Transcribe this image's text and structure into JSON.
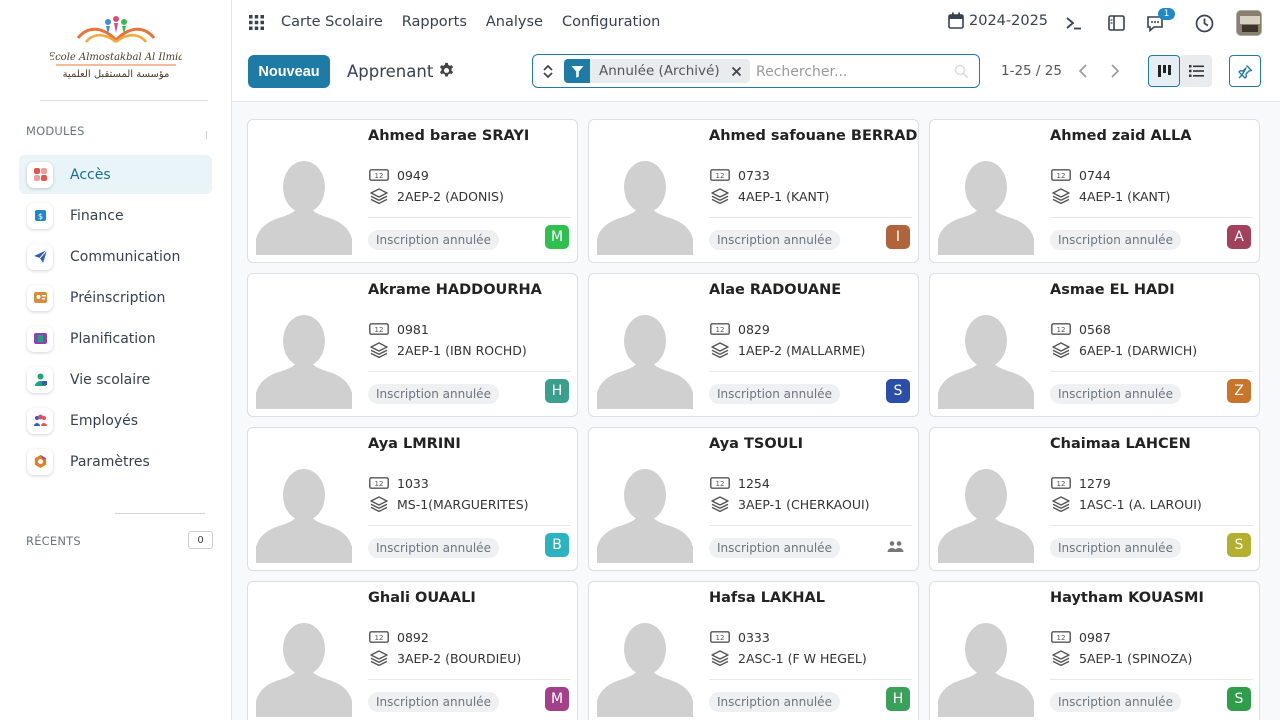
{
  "brand": {
    "logo_text_latin": "Ecole Almostakbal Al Ilmia",
    "logo_text_arabic": "مؤسسة المستقبل العلمية"
  },
  "sidebar": {
    "modules_title": "MODULES",
    "items": [
      {
        "label": "Accès",
        "icon": "access-icon",
        "color": "#e5534b",
        "active": true
      },
      {
        "label": "Finance",
        "icon": "finance-icon",
        "color": "#1e88c8",
        "active": false
      },
      {
        "label": "Communication",
        "icon": "send-icon",
        "color": "#2e5cb8",
        "active": false
      },
      {
        "label": "Préinscription",
        "icon": "enrollment-icon",
        "color": "#d98a3a",
        "active": false
      },
      {
        "label": "Planification",
        "icon": "calendar-icon",
        "color": "#8e44ad",
        "active": false
      },
      {
        "label": "Vie scolaire",
        "icon": "student-life-icon",
        "color": "#1aa57a",
        "active": false
      },
      {
        "label": "Employés",
        "icon": "employees-icon",
        "color": "#d94b7b",
        "active": false
      },
      {
        "label": "Paramètres",
        "icon": "settings-icon",
        "color": "#e67e22",
        "active": false
      }
    ],
    "recents_title": "RÉCENTS",
    "recents_count": "0"
  },
  "topbar": {
    "menu": [
      "Carte Scolaire",
      "Rapports",
      "Analyse",
      "Configuration"
    ],
    "year": "2024-2025",
    "chat_badge": "1"
  },
  "control": {
    "new_button": "Nouveau",
    "title": "Apprenant",
    "facet_label": "Annulée (Archivé)",
    "search_placeholder": "Rechercher...",
    "pager": "1-25 / 25"
  },
  "cards": [
    {
      "name": "Ahmed barae SRAYI",
      "code": "0949",
      "class": "2AEP-2 (ADONIS)",
      "status": "Inscription annulée",
      "letter": "M",
      "color": "#2ebf4f"
    },
    {
      "name": "Ahmed safouane BERRAD",
      "code": "0733",
      "class": "4AEP-1 (KANT)",
      "status": "Inscription annulée",
      "letter": "I",
      "color": "#b0643a"
    },
    {
      "name": "Ahmed zaid ALLA",
      "code": "0744",
      "class": "4AEP-1 (KANT)",
      "status": "Inscription annulée",
      "letter": "A",
      "color": "#a3405a"
    },
    {
      "name": "Akrame HADDOURHA",
      "code": "0981",
      "class": "2AEP-1 (IBN ROCHD)",
      "status": "Inscription annulée",
      "letter": "H",
      "color": "#3a9e8c"
    },
    {
      "name": "Alae RADOUANE",
      "code": "0829",
      "class": "1AEP-2 (MALLARME)",
      "status": "Inscription annulée",
      "letter": "S",
      "color": "#2b4fa8"
    },
    {
      "name": "Asmae EL HADI",
      "code": "0568",
      "class": "6AEP-1 (DARWICH)",
      "status": "Inscription annulée",
      "letter": "Z",
      "color": "#c8742a"
    },
    {
      "name": "Aya LMRINI",
      "code": "1033",
      "class": "MS-1(MARGUERITES)",
      "status": "Inscription annulée",
      "letter": "B",
      "color": "#2bb3bf"
    },
    {
      "name": "Aya TSOULI",
      "code": "1254",
      "class": "3AEP-1 (CHERKAOUI)",
      "status": "Inscription annulée",
      "letter": "",
      "color": ""
    },
    {
      "name": "Chaimaa LAHCEN",
      "code": "1279",
      "class": "1ASC-1 (A. LAROUI)",
      "status": "Inscription annulée",
      "letter": "S",
      "color": "#b3b02e"
    },
    {
      "name": "Ghali OUAALI",
      "code": "0892",
      "class": "3AEP-2 (BOURDIEU)",
      "status": "Inscription annulée",
      "letter": "M",
      "color": "#a3408a"
    },
    {
      "name": "Hafsa LAKHAL",
      "code": "0333",
      "class": "2ASC-1 (F W HEGEL)",
      "status": "Inscription annulée",
      "letter": "H",
      "color": "#3aa05a"
    },
    {
      "name": "Haytham KOUASMI",
      "code": "0987",
      "class": "5AEP-1 (SPINOZA)",
      "status": "Inscription annulée",
      "letter": "S",
      "color": "#2e9e4a"
    }
  ]
}
